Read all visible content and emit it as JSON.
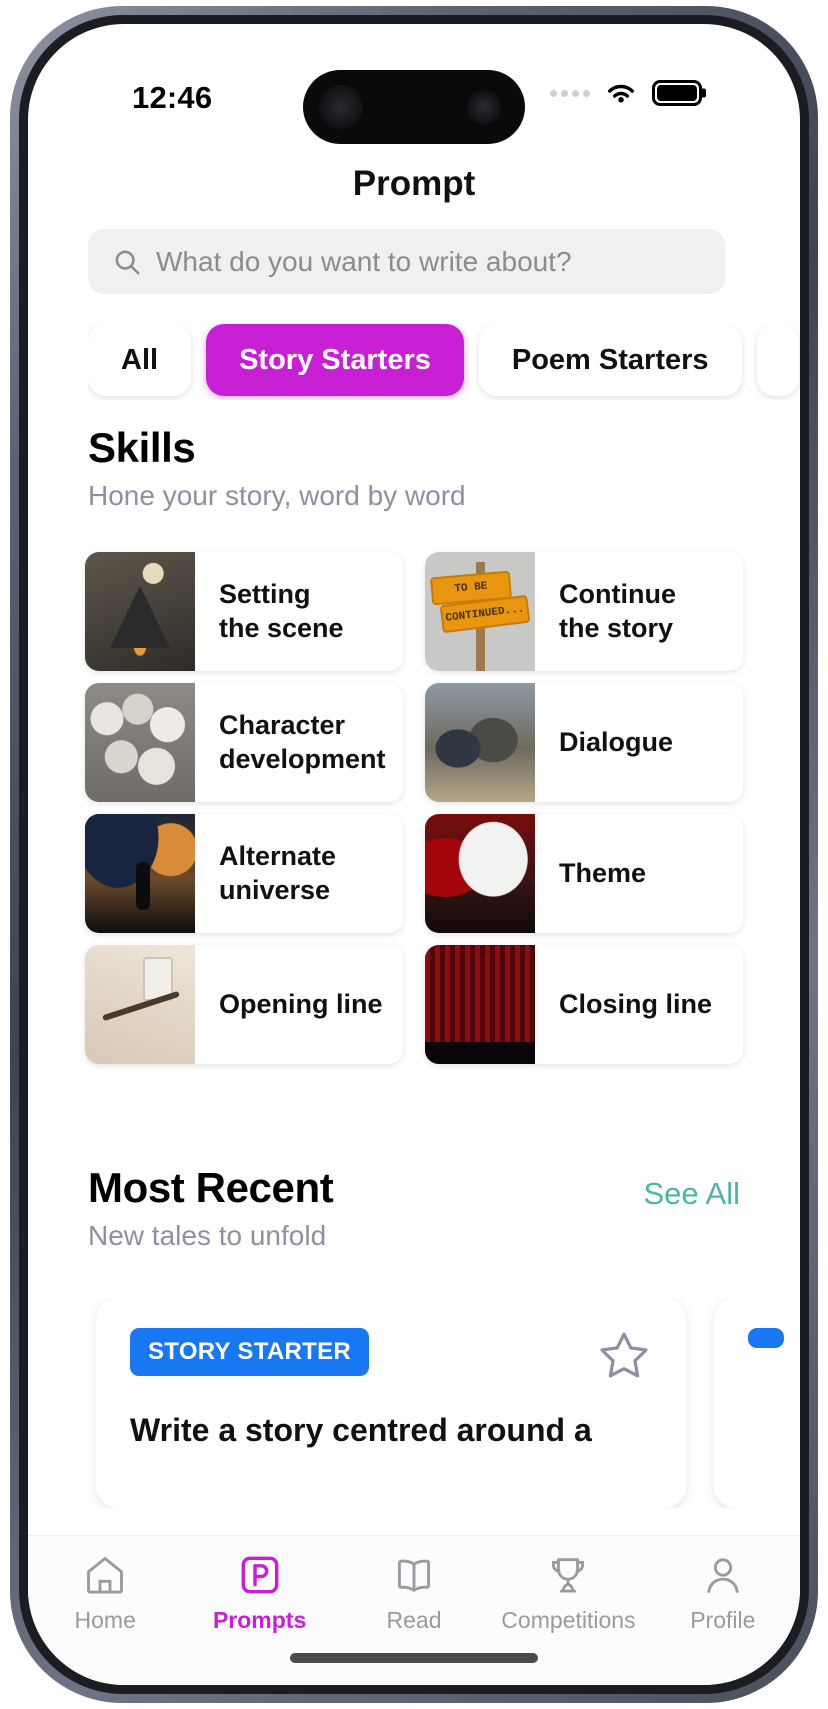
{
  "status_bar": {
    "time": "12:46",
    "wifi_icon": "wifi-icon",
    "battery_icon": "battery-icon",
    "signal_icon": "signal-dots-icon"
  },
  "header": {
    "title": "Prompt"
  },
  "search": {
    "placeholder": "What do you want to write about?",
    "value": "",
    "icon": "search-icon"
  },
  "filters": {
    "chips": [
      {
        "label": "All",
        "active": false
      },
      {
        "label": "Story Starters",
        "active": true
      },
      {
        "label": "Poem Starters",
        "active": false
      },
      {
        "label": "",
        "active": false
      }
    ],
    "active_color": "#c81fd4"
  },
  "skills_section": {
    "title": "Skills",
    "subtitle": "Hone your story, word by word",
    "cards": [
      {
        "label": "Setting\nthe scene",
        "thumb": "haunted-house-thumb"
      },
      {
        "label": "Continue\nthe story",
        "thumb": "to-be-continued-sign-thumb"
      },
      {
        "label": "Character\ndevelopment",
        "thumb": "crowd-of-faces-thumb"
      },
      {
        "label": "Dialogue",
        "thumb": "two-people-talking-thumb"
      },
      {
        "label": "Alternate\nuniverse",
        "thumb": "astronaut-space-thumb"
      },
      {
        "label": "Theme",
        "thumb": "dragon-battle-thumb"
      },
      {
        "label": "Opening line",
        "thumb": "desk-notebook-thumb"
      },
      {
        "label": "Closing line",
        "thumb": "red-curtain-thumb"
      }
    ]
  },
  "recent_section": {
    "title": "Most Recent",
    "subtitle": "New tales to unfold",
    "see_all_label": "See All",
    "see_all_color": "#4cb5a5",
    "cards": [
      {
        "badge": "STORY STARTER",
        "badge_color": "#1877f2",
        "text": "Write a story centred around a",
        "favorite_icon": "star-outline-icon"
      },
      {
        "badge": "",
        "badge_color": "#1877f2",
        "text": "",
        "favorite_icon": "star-outline-icon"
      }
    ]
  },
  "tab_bar": {
    "active_color": "#c81fd4",
    "items": [
      {
        "label": "Home",
        "icon": "home-icon",
        "active": false
      },
      {
        "label": "Prompts",
        "icon": "prompts-p-icon",
        "active": true
      },
      {
        "label": "Read",
        "icon": "book-icon",
        "active": false
      },
      {
        "label": "Competitions",
        "icon": "trophy-icon",
        "active": false
      },
      {
        "label": "Profile",
        "icon": "person-icon",
        "active": false
      }
    ]
  }
}
